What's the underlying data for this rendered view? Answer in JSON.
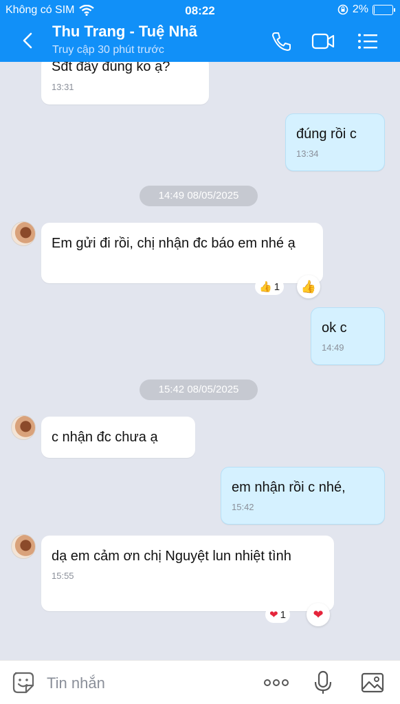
{
  "status": {
    "carrier": "Không có SIM",
    "time": "08:22",
    "battery": "2%",
    "battery_level": 0.02
  },
  "header": {
    "title": "Thu Trang - Tuệ Nhã",
    "subtitle": "Truy cập 30 phút trước"
  },
  "messages": [
    {
      "text": "Sđt đây đúng ko ạ?",
      "time": "13:31"
    },
    {
      "text": "đúng rồi c",
      "time": "13:34"
    },
    {
      "text": "Em gửi đi rồi, chị nhận đc báo em nhé ạ"
    },
    {
      "text": "ok c",
      "time": "14:49"
    },
    {
      "text": "c nhận đc chưa ạ"
    },
    {
      "text": "em nhận rồi c nhé,",
      "time": "15:42"
    },
    {
      "text": "dạ em cảm ơn chị Nguyệt lun nhiệt tình",
      "time": "15:55"
    }
  ],
  "separators": [
    "14:49 08/05/2025",
    "15:42 08/05/2025"
  ],
  "reactions": [
    {
      "emoji": "👍",
      "count": "1",
      "icon": "thumbs-up-icon"
    },
    {
      "emoji": "❤",
      "count": "1",
      "icon": "heart-icon",
      "color": "#e5243b"
    }
  ],
  "input": {
    "placeholder": "Tin nhắn"
  },
  "colors": {
    "header": "#1190f8",
    "outgoing": "#d5f1ff",
    "incoming": "#ffffff",
    "background": "#e2e5ee"
  }
}
